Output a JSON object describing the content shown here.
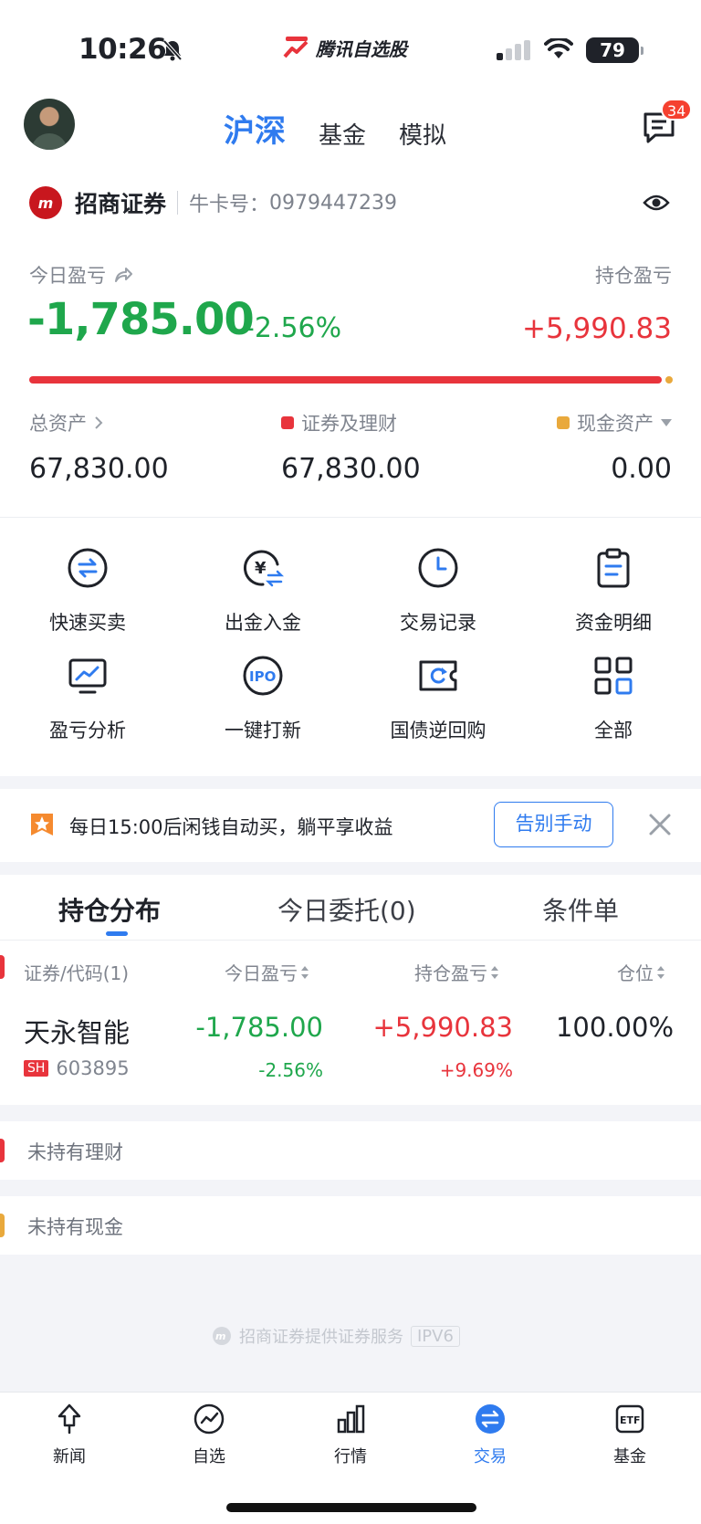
{
  "status_bar": {
    "time": "10:26",
    "app_name": "腾讯自选股",
    "battery": "79"
  },
  "header": {
    "tabs": [
      {
        "label": "沪深",
        "active": true
      },
      {
        "label": "基金",
        "active": false
      },
      {
        "label": "模拟",
        "active": false
      }
    ],
    "message_count": "34"
  },
  "broker": {
    "name": "招商证券",
    "account_label": "牛卡号：",
    "account_number": "0979447239"
  },
  "pnl": {
    "today_label": "今日盈亏",
    "today_value": "-1,785.00",
    "today_pct": "-2.56%",
    "holding_label": "持仓盈亏",
    "holding_value": "+5,990.83",
    "securities_share": 1.0
  },
  "assets": {
    "total_label": "总资产",
    "total_value": "67,830.00",
    "securities_label": "证券及理财",
    "securities_value": "67,830.00",
    "cash_label": "现金资产",
    "cash_value": "0.00"
  },
  "quick_actions": [
    {
      "label": "快速买卖",
      "icon": "swap-circle-icon"
    },
    {
      "label": "出金入金",
      "icon": "yuan-transfer-icon"
    },
    {
      "label": "交易记录",
      "icon": "clock-icon"
    },
    {
      "label": "资金明细",
      "icon": "clipboard-icon"
    },
    {
      "label": "盈亏分析",
      "icon": "monitor-chart-icon"
    },
    {
      "label": "一键打新",
      "icon": "ipo-icon"
    },
    {
      "label": "国债逆回购",
      "icon": "ticket-refresh-icon"
    },
    {
      "label": "全部",
      "icon": "grid-icon"
    }
  ],
  "promo": {
    "text": "每日15:00后闲钱自动买，躺平享收益",
    "button": "告别手动"
  },
  "holdings": {
    "tabs": [
      "持仓分布",
      "今日委托(0)",
      "条件单"
    ],
    "columns": [
      "证券/代码(1)",
      "今日盈亏",
      "持仓盈亏",
      "仓位"
    ],
    "rows": [
      {
        "name": "天永智能",
        "market": "SH",
        "code": "603895",
        "today_pnl": "-1,785.00",
        "today_pct": "-2.56%",
        "holding_pnl": "+5,990.83",
        "holding_pct": "+9.69%",
        "position": "100.00%"
      }
    ],
    "empty_wealth": "未持有理财",
    "empty_cash": "未持有现金"
  },
  "footer": {
    "note": "招商证券提供证券服务",
    "tag": "IPV6"
  },
  "bottom_nav": [
    {
      "label": "新闻",
      "active": false
    },
    {
      "label": "自选",
      "active": false
    },
    {
      "label": "行情",
      "active": false
    },
    {
      "label": "交易",
      "active": true
    },
    {
      "label": "基金",
      "active": false
    }
  ],
  "colors": {
    "accent": "#2f7bef",
    "up": "#e8343c",
    "down": "#1fa74c",
    "cash": "#e9a93c"
  }
}
